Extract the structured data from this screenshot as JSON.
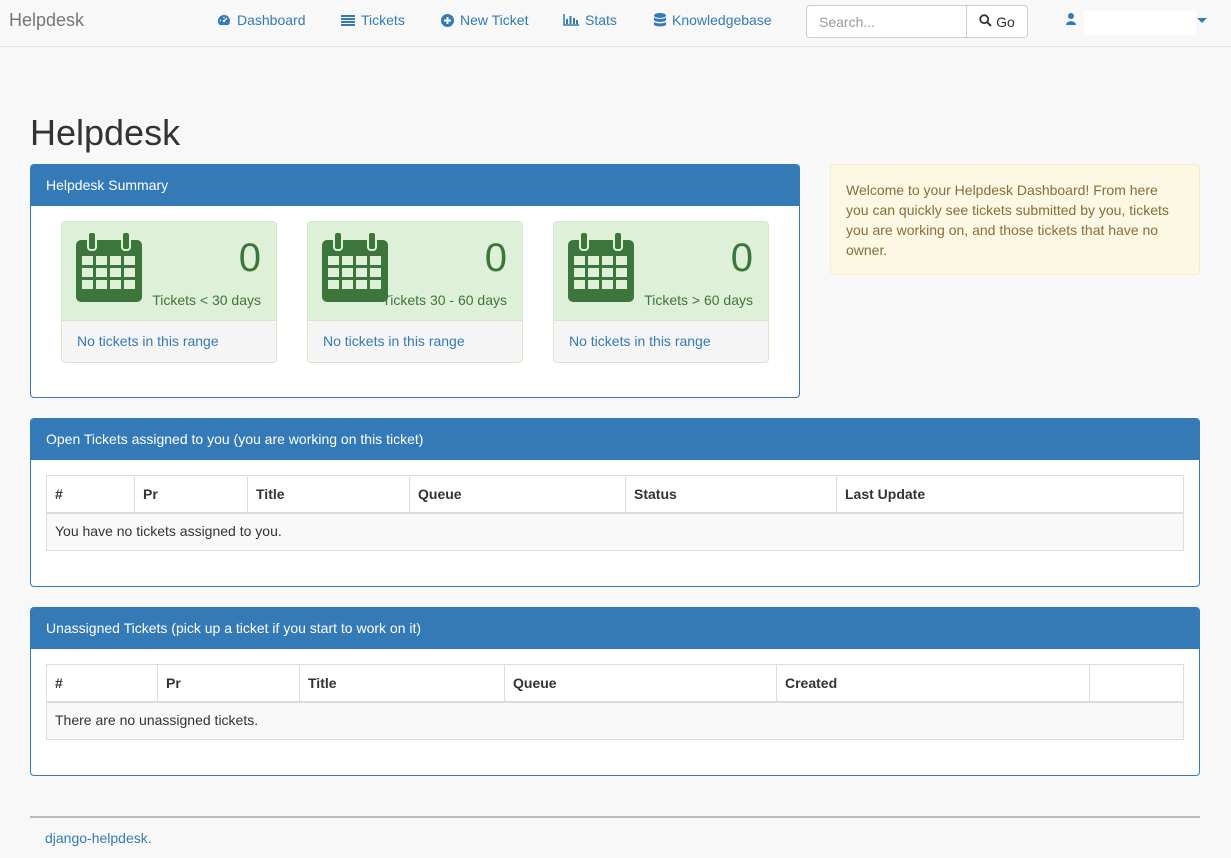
{
  "navbar": {
    "brand": "Helpdesk",
    "links": [
      {
        "label": "Dashboard",
        "icon": "dashboard-icon"
      },
      {
        "label": "Tickets",
        "icon": "tickets-list-icon"
      },
      {
        "label": "New Ticket",
        "icon": "plus-circle-icon"
      },
      {
        "label": "Stats",
        "icon": "bar-chart-icon"
      },
      {
        "label": "Knowledgebase",
        "icon": "database-icon"
      }
    ],
    "search_placeholder": "Search...",
    "go_label": "Go"
  },
  "page_title": "Helpdesk",
  "summary": {
    "heading": "Helpdesk Summary",
    "cards": [
      {
        "count": "0",
        "label": "Tickets < 30 days",
        "footer": "No tickets in this range"
      },
      {
        "count": "0",
        "label": "Tickets 30 - 60 days",
        "footer": "No tickets in this range"
      },
      {
        "count": "0",
        "label": "Tickets > 60 days",
        "footer": "No tickets in this range"
      }
    ]
  },
  "welcome_text": "Welcome to your Helpdesk Dashboard! From here you can quickly see tickets submitted by you, tickets you are working on, and those tickets that have no owner.",
  "assigned": {
    "heading": "Open Tickets assigned to you (you are working on this ticket)",
    "columns": [
      "#",
      "Pr",
      "Title",
      "Queue",
      "Status",
      "Last Update"
    ],
    "empty": "You have no tickets assigned to you."
  },
  "unassigned": {
    "heading": "Unassigned Tickets (pick up a ticket if you start to work on it)",
    "columns": [
      "#",
      "Pr",
      "Title",
      "Queue",
      "Created",
      ""
    ],
    "empty": "There are no unassigned tickets."
  },
  "footer": {
    "link": "django-helpdesk."
  },
  "colors": {
    "primary": "#337ab7",
    "success_bg": "#dff0d8",
    "success_text": "#3c763d",
    "warning_bg": "#fcf8e3",
    "warning_text": "#8a6d3b"
  }
}
